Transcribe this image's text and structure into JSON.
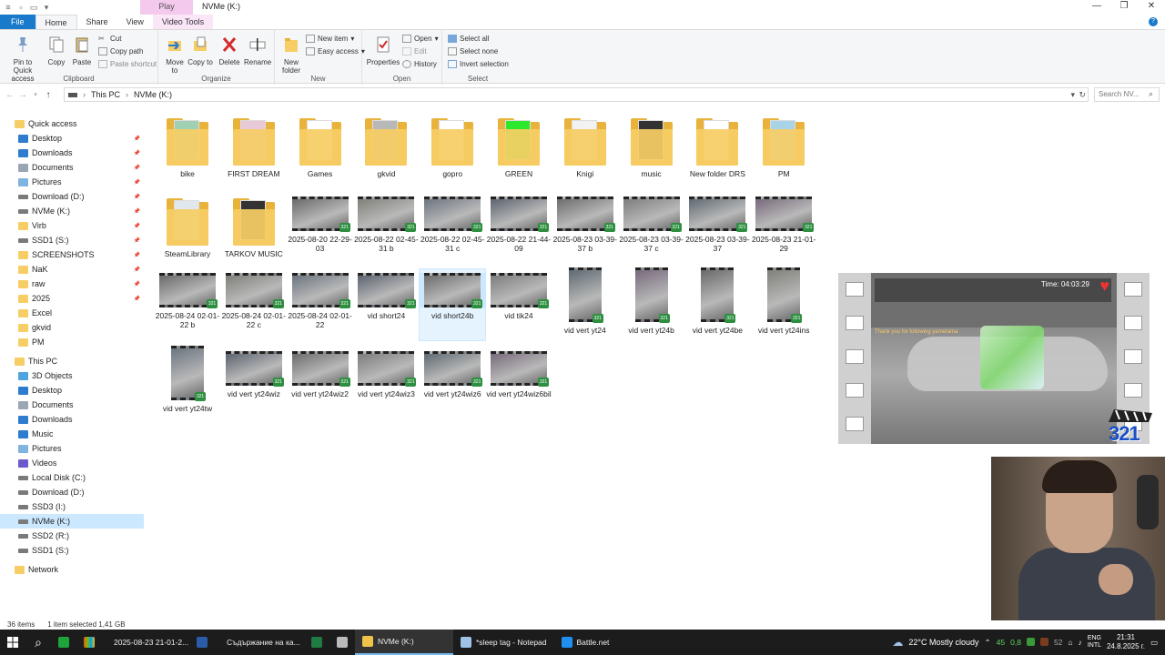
{
  "window": {
    "contextual_tab": "Play",
    "title": "NVMe (K:)",
    "minimize": "—",
    "maximize": "❐",
    "close": "✕"
  },
  "ribbon_tabs": [
    "File",
    "Home",
    "Share",
    "View",
    "Video Tools"
  ],
  "ribbon": {
    "clipboard": {
      "label": "Clipboard",
      "pin": "Pin to Quick access",
      "copy": "Copy",
      "paste": "Paste",
      "cut": "Cut",
      "copy_path": "Copy path",
      "paste_shortcut": "Paste shortcut"
    },
    "organize": {
      "label": "Organize",
      "move_to": "Move to",
      "copy_to": "Copy to",
      "delete": "Delete",
      "rename": "Rename"
    },
    "new": {
      "label": "New",
      "new_folder": "New folder",
      "new_item": "New item",
      "easy_access": "Easy access"
    },
    "open": {
      "label": "Open",
      "properties": "Properties",
      "open": "Open",
      "edit": "Edit",
      "history": "History"
    },
    "select": {
      "label": "Select",
      "select_all": "Select all",
      "select_none": "Select none",
      "invert_selection": "Invert selection"
    }
  },
  "address": {
    "crumbs": [
      "This PC",
      "NVMe (K:)"
    ],
    "search_placeholder": "Search NV..."
  },
  "nav": {
    "quick_access": "Quick access",
    "quick_items": [
      "Desktop",
      "Downloads",
      "Documents",
      "Pictures",
      "Download (D:)",
      "NVMe (K:)",
      "Virb",
      "SSD1 (S:)",
      "SCREENSHOTS",
      "NaK",
      "raw",
      "2025",
      "Excel",
      "gkvid",
      "PM"
    ],
    "this_pc": "This PC",
    "pc_items": [
      "3D Objects",
      "Desktop",
      "Documents",
      "Downloads",
      "Music",
      "Pictures",
      "Videos",
      "Local Disk (C:)",
      "Download (D:)",
      "SSD3 (I:)",
      "NVMe (K:)",
      "SSD2 (R:)",
      "SSD1 (S:)"
    ],
    "network": "Network"
  },
  "files": [
    {
      "name": "bike",
      "type": "folder"
    },
    {
      "name": "FIRST DREAM",
      "type": "folder"
    },
    {
      "name": "Games",
      "type": "folder"
    },
    {
      "name": "gkvid",
      "type": "folder"
    },
    {
      "name": "gopro",
      "type": "folder"
    },
    {
      "name": "GREEN",
      "type": "folder"
    },
    {
      "name": "Knigi",
      "type": "folder"
    },
    {
      "name": "music",
      "type": "folder"
    },
    {
      "name": "New folder DRS",
      "type": "folder"
    },
    {
      "name": "PM",
      "type": "folder"
    },
    {
      "name": "SteamLibrary",
      "type": "folder"
    },
    {
      "name": "TARKOV MUSIC",
      "type": "folder"
    },
    {
      "name": "2025-08-20 22-29-03",
      "type": "video"
    },
    {
      "name": "2025-08-22 02-45-31 b",
      "type": "video"
    },
    {
      "name": "2025-08-22 02-45-31 c",
      "type": "video"
    },
    {
      "name": "2025-08-22 21-44-09",
      "type": "video"
    },
    {
      "name": "2025-08-23 03-39-37 b",
      "type": "video"
    },
    {
      "name": "2025-08-23 03-39-37 c",
      "type": "video"
    },
    {
      "name": "2025-08-23 03-39-37",
      "type": "video"
    },
    {
      "name": "2025-08-23 21-01-29",
      "type": "video"
    },
    {
      "name": "2025-08-24 02-01-22 b",
      "type": "video"
    },
    {
      "name": "2025-08-24 02-01-22 c",
      "type": "video"
    },
    {
      "name": "2025-08-24 02-01-22",
      "type": "video"
    },
    {
      "name": "vid short24",
      "type": "video"
    },
    {
      "name": "vid short24b",
      "type": "video",
      "selected": true
    },
    {
      "name": "vid tik24",
      "type": "video"
    },
    {
      "name": "vid vert yt24",
      "type": "vvideo"
    },
    {
      "name": "vid vert yt24b",
      "type": "vvideo"
    },
    {
      "name": "vid vert yt24be",
      "type": "vvideo"
    },
    {
      "name": "vid vert yt24ins",
      "type": "vvideo"
    },
    {
      "name": "vid vert yt24tw",
      "type": "vvideo"
    },
    {
      "name": "vid vert yt24wiz",
      "type": "video"
    },
    {
      "name": "vid vert yt24wiz2",
      "type": "video"
    },
    {
      "name": "vid vert yt24wiz3",
      "type": "video"
    },
    {
      "name": "vid vert yt24wiz6",
      "type": "video"
    },
    {
      "name": "vid vert yt24wiz6bil",
      "type": "video"
    }
  ],
  "preview": {
    "time": "Time: 04:03:29",
    "follow_text": "Thank you for following yametama",
    "logo": "321"
  },
  "status": {
    "count": "36 items",
    "selection": "1 item selected  1,41 GB"
  },
  "taskbar": {
    "apps": [
      {
        "label": "2025-08-23 21-01-2...",
        "color": "#777777"
      },
      {
        "label": "",
        "color": "#2a5caa"
      },
      {
        "label": "Съдържание на ка...",
        "color": "#d9463b"
      },
      {
        "label": "",
        "color": "#1f7a44"
      },
      {
        "label": "",
        "color": "#bbbbbb"
      },
      {
        "label": "NVMe (K:)",
        "color": "#f1c24a",
        "active": true
      },
      {
        "label": "*sleep tag - Notepad",
        "color": "#9ec3e6"
      },
      {
        "label": "Battle.net",
        "color": "#1f8ff0"
      }
    ],
    "weather": "22°C  Mostly cloudy",
    "tray_nums": [
      "45",
      "0,8",
      "52"
    ],
    "lang": "ENG\nINTL",
    "time": "21:31",
    "date": "24.8.2025 г."
  },
  "colors": {
    "accent": "#1979ca",
    "selection": "#cce8ff",
    "folder": "#f6ce65"
  }
}
